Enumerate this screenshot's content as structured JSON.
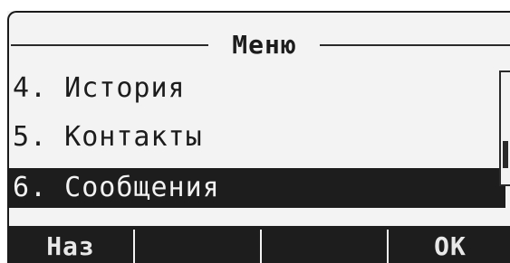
{
  "screen": {
    "title": "Меню",
    "menu_items": [
      {
        "label": "4. История",
        "selected": false
      },
      {
        "label": "5. Контакты",
        "selected": false
      },
      {
        "label": "6. Сообщения",
        "selected": true
      }
    ],
    "scrollbar_position": 0.82
  },
  "softkeys": {
    "key1": "Наз",
    "key2": "",
    "key3": "",
    "key4": "ОК"
  },
  "colors": {
    "lcd_background": "#f3f3f3",
    "lcd_foreground": "#1d1d1d"
  }
}
